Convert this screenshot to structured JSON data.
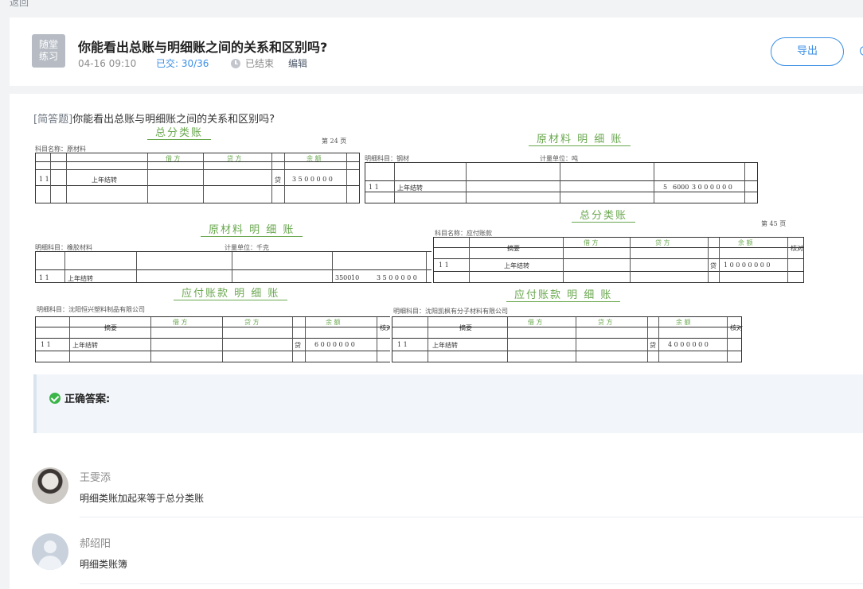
{
  "breadcrumb": "返回",
  "header": {
    "badge_line1": "随堂",
    "badge_line2": "练习",
    "title": "你能看出总账与明细账之间的关系和区别吗?",
    "date": "04-16 09:10",
    "submitted": "已交: 30/36",
    "status": "已结束",
    "edit_label": "编辑",
    "export_label": "导出"
  },
  "question": {
    "type_label": "[简答题]",
    "text": "你能看出总账与明细账之间的关系和区别吗?"
  },
  "ledgers": {
    "l1": {
      "title": "总分类账",
      "page": "第  24  页",
      "account": "科目名称：原材料",
      "row_text": "上年结转",
      "amount": "3 5 0 0 0 0 0",
      "direction": "贷",
      "date": "1  1"
    },
    "l2": {
      "title": "原材料 明 细 账",
      "account": "明细科目：钢材",
      "unit": "计量单位：吨",
      "row_text": "上年结转",
      "qty": "5",
      "price": "6000",
      "amount": "3 0 0 0 0 0 0",
      "date": "1  1"
    },
    "l3": {
      "title": "原材料 明 细 账",
      "account": "明细科目：橡胶材料",
      "unit": "计量单位：千克",
      "row_text": "上年结转",
      "qty": "3500",
      "price": "10",
      "amount": "3 5 0 0 0 0 0",
      "date": "1  1"
    },
    "l4": {
      "title": "总分类账",
      "page": "第  45  页",
      "account": "科目名称：应付账款",
      "summary": "摘要",
      "debit": "借  方",
      "credit": "贷  方",
      "balance": "余  额",
      "row_text": "上年结转",
      "amount": "1 0 0 0 0 0 0 0",
      "direction": "贷",
      "check": "核对",
      "date": "1  1"
    },
    "l5": {
      "title": "应付账款 明 细 账",
      "account": "明细科目：沈阳恒兴塑料制品有限公司",
      "summary": "摘要",
      "debit": "借  方",
      "credit": "贷  方",
      "balance": "余  额",
      "row_text": "上年结转",
      "amount": "6 0 0 0 0 0 0",
      "direction": "贷",
      "check": "核对",
      "date": "1  1"
    },
    "l6": {
      "title": "应付账款 明 细 账",
      "account": "明细科目：沈阳凯枫有分子材料有限公司",
      "summary": "摘要",
      "debit": "借  方",
      "credit": "贷  方",
      "balance": "余  额",
      "row_text": "上年结转",
      "amount": "4 0 0 0 0 0 0",
      "direction": "贷",
      "check": "核对",
      "date": "1  1"
    }
  },
  "answer": {
    "label": "正确答案:"
  },
  "comments": [
    {
      "name": "王雯添",
      "text": "明细类账加起来等于总分类账"
    },
    {
      "name": "郝绍阳",
      "text": "明细类账簿"
    }
  ]
}
